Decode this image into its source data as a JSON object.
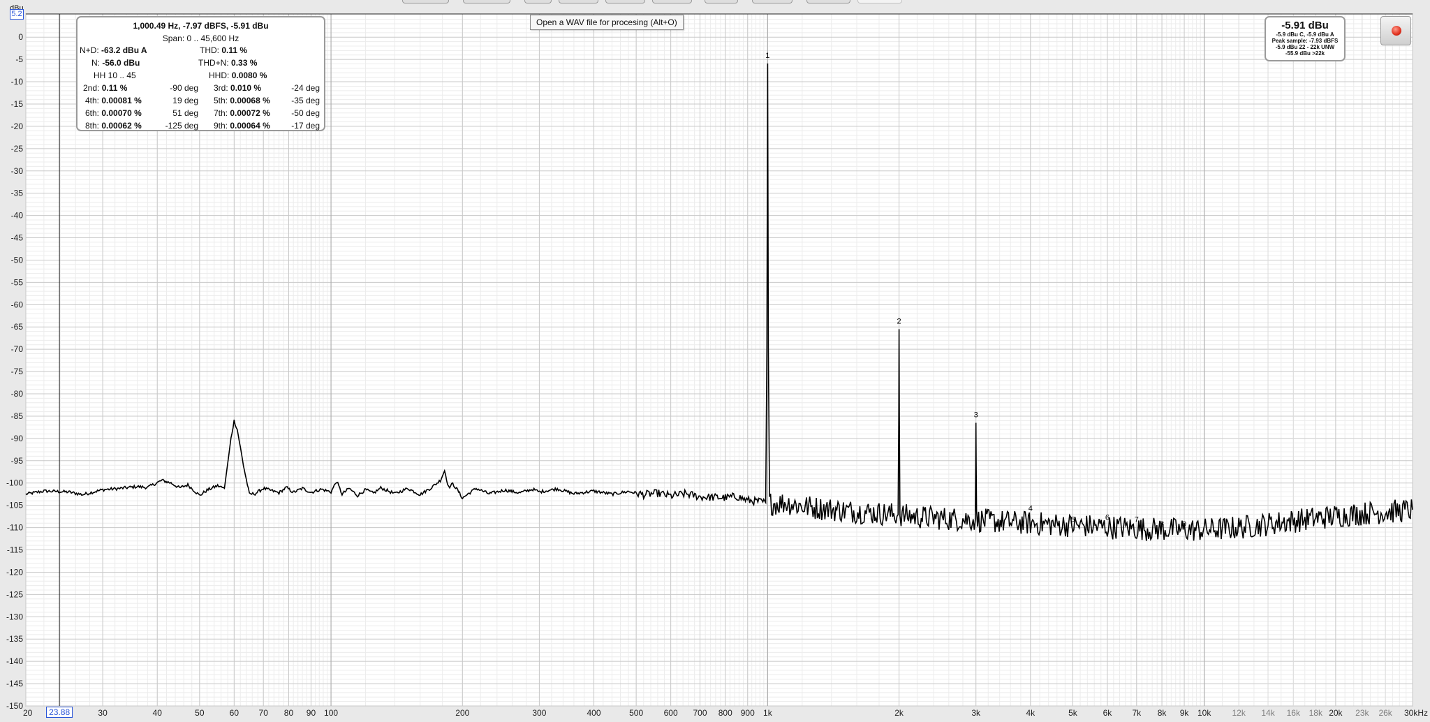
{
  "tooltip": "Open a WAV file for procesing (Alt+O)",
  "y_unit": "dBu",
  "cursor": {
    "level_label": "5.2",
    "freq_label": "23.88"
  },
  "stats": {
    "header": "1,000.49 Hz, -7.97 dBFS, -5.91 dBu",
    "span": "Span: 0 .. 45,600 Hz",
    "nd_label": "N+D:",
    "nd_value": "-63.2 dBu A",
    "thd_label": "THD:",
    "thd_value": "0.11 %",
    "n_label": "N:",
    "n_value": "-56.0 dBu",
    "thdn_label": "THD+N:",
    "thdn_value": "0.33 %",
    "hh_label": "HH 10 .. 45",
    "hhd_label": "HHD:",
    "hhd_value": "0.0080 %",
    "harmonics": [
      {
        "label": "2nd:",
        "value": "0.11 %",
        "phase": "-90 deg"
      },
      {
        "label": "3rd:",
        "value": "0.010 %",
        "phase": "-24 deg"
      },
      {
        "label": "4th:",
        "value": "0.00081 %",
        "phase": "19 deg"
      },
      {
        "label": "5th:",
        "value": "0.00068 %",
        "phase": "-35 deg"
      },
      {
        "label": "6th:",
        "value": "0.00070 %",
        "phase": "51 deg"
      },
      {
        "label": "7th:",
        "value": "0.00072 %",
        "phase": "-50 deg"
      },
      {
        "label": "8th:",
        "value": "0.00062 %",
        "phase": "-125 deg"
      },
      {
        "label": "9th:",
        "value": "0.00064 %",
        "phase": "-17 deg"
      }
    ]
  },
  "level_meter": {
    "main": "-5.91 dBu",
    "line1": "-5.9 dBu C, -5.9 dBu A",
    "line2": "Peak sample: -7.93 dBFS",
    "line3": "-5.9 dBu 22 - 22k UNW",
    "line4": "-55.9 dBu >22k"
  },
  "colors": {
    "plot_bg": "#ffffff",
    "grid_major": "#c8c8c8",
    "grid_minor": "#ececec",
    "trace": "#000000",
    "cursor_accent": "#2a55d8",
    "record_red": "#e0301e"
  },
  "chart_data": {
    "type": "line",
    "xscale": "log",
    "xlim": [
      20,
      30000
    ],
    "ylim": [
      -150,
      5.2
    ],
    "ylabel": "dBu",
    "grid": true,
    "y_ticks": [
      0,
      -5,
      -10,
      -15,
      -20,
      -25,
      -30,
      -35,
      -40,
      -45,
      -50,
      -55,
      -60,
      -65,
      -70,
      -75,
      -80,
      -85,
      -90,
      -95,
      -100,
      -105,
      -110,
      -115,
      -120,
      -125,
      -130,
      -135,
      -140,
      -145,
      -150
    ],
    "x_ticks": [
      {
        "f": 20,
        "label": "20",
        "major": true
      },
      {
        "f": 30,
        "label": "30",
        "major": true
      },
      {
        "f": 40,
        "label": "40",
        "major": true
      },
      {
        "f": 50,
        "label": "50",
        "major": true
      },
      {
        "f": 60,
        "label": "60",
        "major": true
      },
      {
        "f": 70,
        "label": "70",
        "major": true
      },
      {
        "f": 80,
        "label": "80",
        "major": true
      },
      {
        "f": 90,
        "label": "90",
        "major": true
      },
      {
        "f": 100,
        "label": "100",
        "major": true
      },
      {
        "f": 200,
        "label": "200",
        "major": true
      },
      {
        "f": 300,
        "label": "300",
        "major": true
      },
      {
        "f": 400,
        "label": "400",
        "major": true
      },
      {
        "f": 500,
        "label": "500",
        "major": true
      },
      {
        "f": 600,
        "label": "600",
        "major": true
      },
      {
        "f": 700,
        "label": "700",
        "major": true
      },
      {
        "f": 800,
        "label": "800",
        "major": true
      },
      {
        "f": 900,
        "label": "900",
        "major": true
      },
      {
        "f": 1000,
        "label": "1k",
        "major": true
      },
      {
        "f": 2000,
        "label": "2k",
        "major": true
      },
      {
        "f": 3000,
        "label": "3k",
        "major": true
      },
      {
        "f": 4000,
        "label": "4k",
        "major": true
      },
      {
        "f": 5000,
        "label": "5k",
        "major": true
      },
      {
        "f": 6000,
        "label": "6k",
        "major": true
      },
      {
        "f": 7000,
        "label": "7k",
        "major": true
      },
      {
        "f": 8000,
        "label": "8k",
        "major": true
      },
      {
        "f": 9000,
        "label": "9k",
        "major": true
      },
      {
        "f": 10000,
        "label": "10k",
        "major": true
      },
      {
        "f": 12000,
        "label": "12k",
        "major": false
      },
      {
        "f": 14000,
        "label": "14k",
        "major": false
      },
      {
        "f": 16000,
        "label": "16k",
        "major": false
      },
      {
        "f": 18000,
        "label": "18k",
        "major": false
      },
      {
        "f": 20000,
        "label": "20k",
        "major": true
      },
      {
        "f": 23000,
        "label": "23k",
        "major": false
      },
      {
        "f": 26000,
        "label": "26k",
        "major": false
      },
      {
        "f": 30000,
        "label": "30kHz",
        "major": true
      }
    ],
    "cursor": {
      "x": 23.88,
      "y": 5.2
    },
    "harmonic_markers": [
      {
        "n": "1",
        "f": 1000,
        "dbu": -5.9
      },
      {
        "n": "2",
        "f": 2000,
        "dbu": -65.5
      },
      {
        "n": "3",
        "f": 3000,
        "dbu": -86.5
      },
      {
        "n": "4",
        "f": 4000,
        "dbu": -107.5
      },
      {
        "n": "5",
        "f": 5000,
        "dbu": -110
      },
      {
        "n": "6",
        "f": 6000,
        "dbu": -109.5
      },
      {
        "n": "7",
        "f": 7000,
        "dbu": -110
      },
      {
        "n": "8",
        "f": 8000,
        "dbu": -111
      },
      {
        "n": "9",
        "f": 9000,
        "dbu": -111
      }
    ],
    "series": [
      {
        "points": [
          [
            20,
            -102.5
          ],
          [
            22,
            -101.8
          ],
          [
            25,
            -102.0
          ],
          [
            27,
            -102.6
          ],
          [
            30,
            -101.5
          ],
          [
            33,
            -101.2
          ],
          [
            36,
            -100.8
          ],
          [
            38,
            -101.0
          ],
          [
            41,
            -99.4
          ],
          [
            43,
            -100.0
          ],
          [
            45,
            -101.1
          ],
          [
            47,
            -100.4
          ],
          [
            50,
            -102.8
          ],
          [
            52,
            -101.6
          ],
          [
            55,
            -100.6
          ],
          [
            57,
            -101.2
          ],
          [
            59,
            -90.0
          ],
          [
            60,
            -86.0
          ],
          [
            61,
            -88.0
          ],
          [
            63,
            -96.0
          ],
          [
            65,
            -102.5
          ],
          [
            67,
            -102.4
          ],
          [
            70,
            -101.2
          ],
          [
            73,
            -101.7
          ],
          [
            76,
            -102.2
          ],
          [
            79,
            -101.0
          ],
          [
            82,
            -102.1
          ],
          [
            86,
            -101.2
          ],
          [
            90,
            -102.1
          ],
          [
            95,
            -101.4
          ],
          [
            100,
            -102.0
          ],
          [
            103,
            -99.6
          ],
          [
            106,
            -102.5
          ],
          [
            110,
            -101.2
          ],
          [
            115,
            -102.8
          ],
          [
            120,
            -101.5
          ],
          [
            125,
            -102.3
          ],
          [
            130,
            -101.1
          ],
          [
            140,
            -102.4
          ],
          [
            150,
            -101.2
          ],
          [
            160,
            -102.6
          ],
          [
            170,
            -101.0
          ],
          [
            178,
            -99.4
          ],
          [
            182,
            -97.2
          ],
          [
            186,
            -101.0
          ],
          [
            190,
            -100.2
          ],
          [
            195,
            -101.6
          ],
          [
            200,
            -103.4
          ],
          [
            205,
            -102.6
          ],
          [
            215,
            -101.2
          ],
          [
            230,
            -102.4
          ],
          [
            250,
            -101.6
          ],
          [
            270,
            -102.2
          ],
          [
            290,
            -101.4
          ],
          [
            300,
            -102.0
          ],
          [
            330,
            -101.3
          ],
          [
            360,
            -102.4
          ],
          [
            400,
            -101.8
          ],
          [
            440,
            -102.5
          ],
          [
            480,
            -101.9
          ],
          [
            520,
            -102.6
          ],
          [
            560,
            -102.3
          ],
          [
            600,
            -102.9
          ],
          [
            650,
            -102.4
          ],
          [
            700,
            -103.1
          ],
          [
            750,
            -103.2
          ],
          [
            800,
            -103.3
          ],
          [
            850,
            -103.0
          ],
          [
            900,
            -103.9
          ],
          [
            960,
            -104.2
          ],
          [
            990,
            -104.4
          ],
          [
            996,
            -70.0
          ],
          [
            1000,
            -5.9
          ],
          [
            1004,
            -70.0
          ],
          [
            1010,
            -104.5
          ],
          [
            1050,
            -104.6
          ],
          [
            1100,
            -104.4
          ],
          [
            1200,
            -105.2
          ],
          [
            1300,
            -105.6
          ],
          [
            1400,
            -105.9
          ],
          [
            1500,
            -106.2
          ],
          [
            1600,
            -106.4
          ],
          [
            1700,
            -106.6
          ],
          [
            1800,
            -106.8
          ],
          [
            1900,
            -107.0
          ],
          [
            1990,
            -107.1
          ],
          [
            1997,
            -85.0
          ],
          [
            2000,
            -65.5
          ],
          [
            2003,
            -85.0
          ],
          [
            2010,
            -107.2
          ],
          [
            2200,
            -107.6
          ],
          [
            2400,
            -107.8
          ],
          [
            2600,
            -108.0
          ],
          [
            2800,
            -108.1
          ],
          [
            2990,
            -108.2
          ],
          [
            2997,
            -95.0
          ],
          [
            3000,
            -86.5
          ],
          [
            3003,
            -95.0
          ],
          [
            3010,
            -108.3
          ],
          [
            3300,
            -108.6
          ],
          [
            3600,
            -108.8
          ],
          [
            4000,
            -109.0
          ],
          [
            4500,
            -109.3
          ],
          [
            5000,
            -109.5
          ],
          [
            5500,
            -109.7
          ],
          [
            6000,
            -109.9
          ],
          [
            6500,
            -110.0
          ],
          [
            7000,
            -110.2
          ],
          [
            7500,
            -110.3
          ],
          [
            8000,
            -110.4
          ],
          [
            9000,
            -110.5
          ],
          [
            10000,
            -110.5
          ],
          [
            11000,
            -110.3
          ],
          [
            12000,
            -110.0
          ],
          [
            13000,
            -109.6
          ],
          [
            14000,
            -109.2
          ],
          [
            15000,
            -108.8
          ],
          [
            16000,
            -108.5
          ],
          [
            17000,
            -108.2
          ],
          [
            18000,
            -107.9
          ],
          [
            19000,
            -107.7
          ],
          [
            20000,
            -107.4
          ],
          [
            22000,
            -107.0
          ],
          [
            24000,
            -106.7
          ],
          [
            26000,
            -106.5
          ],
          [
            28000,
            -106.3
          ],
          [
            30000,
            -106.0
          ]
        ],
        "noise_floor_band_db": 3
      }
    ]
  }
}
